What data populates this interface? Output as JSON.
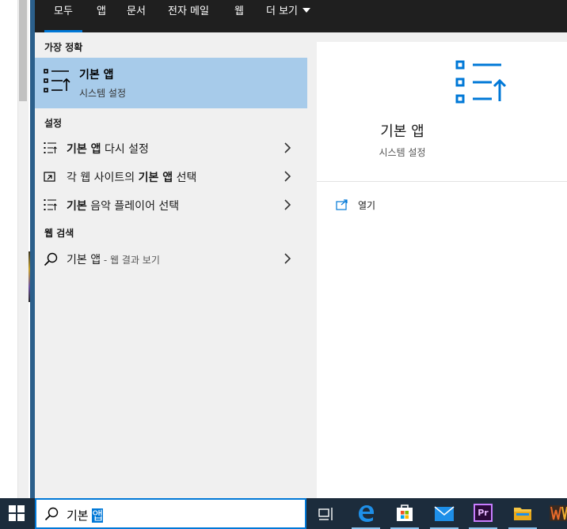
{
  "tabs": [
    {
      "label": "모두",
      "active": true
    },
    {
      "label": "앱",
      "active": false
    },
    {
      "label": "문서",
      "active": false
    },
    {
      "label": "전자 메일",
      "active": false
    },
    {
      "label": "웹",
      "active": false
    },
    {
      "label": "더 보기",
      "active": false
    }
  ],
  "best_match": {
    "header": "가장 정확",
    "title": "기본 앱",
    "subtitle": "시스템 설정"
  },
  "settings": {
    "header": "설정",
    "items": [
      {
        "bold": "기본 앱",
        "rest": " 다시 설정"
      },
      {
        "pre": "각 웹 사이트의 ",
        "bold": "기본 앱",
        "rest": " 선택"
      },
      {
        "bold": "기본",
        "rest": " 음악 플레이어 선택"
      }
    ]
  },
  "web": {
    "header": "웹 검색",
    "item": {
      "query": "기본 앱",
      "suffix": " - 웹 결과 보기"
    }
  },
  "preview": {
    "title": "기본 앱",
    "subtitle": "시스템 설정",
    "open_label": "열기"
  },
  "search": {
    "text_before": "기본 ",
    "text_selected": "앱"
  },
  "taskbar": {
    "icons": [
      "windows-start-icon",
      "task-view-icon",
      "edge-icon",
      "store-icon",
      "mail-icon",
      "premiere-pro-icon",
      "file-explorer-icon",
      "app-icon"
    ],
    "premiere_label": "Pr"
  },
  "colors": {
    "accent": "#0078d7",
    "selection": "#a7cbea",
    "topbar": "#1f1f1f",
    "taskbar": "#1c2c3c"
  }
}
